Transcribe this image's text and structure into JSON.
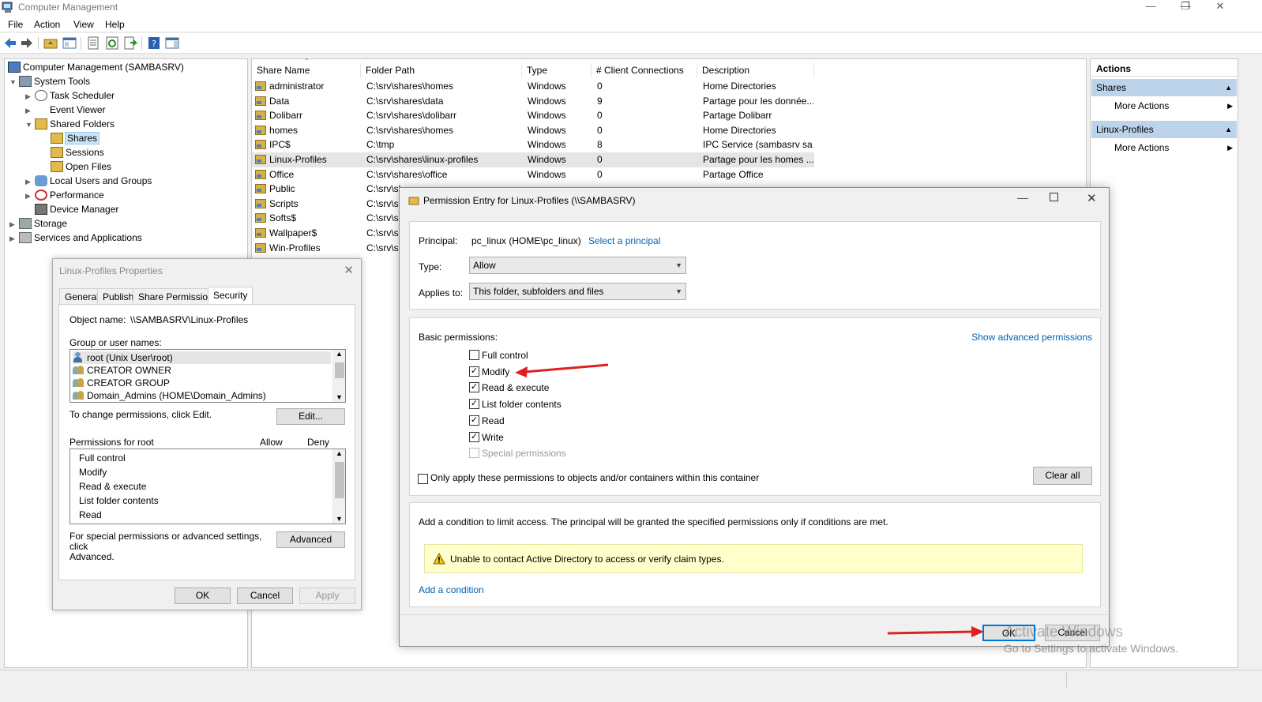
{
  "window": {
    "title": "Computer Management",
    "controls": [
      "minimize",
      "restore",
      "close"
    ]
  },
  "menu": [
    "File",
    "Action",
    "View",
    "Help"
  ],
  "toolbar": [
    "back-icon",
    "forward-icon",
    "up-folder-icon",
    "show-hide-tree-icon",
    "properties-icon",
    "refresh-icon",
    "export-list-icon",
    "help-icon",
    "action-pane-icon"
  ],
  "tree": {
    "root": "Computer Management (SAMBASRV)",
    "system_tools": "System Tools",
    "task_scheduler": "Task Scheduler",
    "event_viewer": "Event Viewer",
    "shared_folders": "Shared Folders",
    "shares": "Shares",
    "sessions": "Sessions",
    "open_files": "Open Files",
    "local_users": "Local Users and Groups",
    "performance": "Performance",
    "device_manager": "Device Manager",
    "storage": "Storage",
    "services": "Services and Applications"
  },
  "list": {
    "columns": [
      "Share Name",
      "Folder Path",
      "Type",
      "# Client Connections",
      "Description"
    ],
    "rows": [
      {
        "name": "administrator",
        "path": "C:\\srv\\shares\\homes",
        "type": "Windows",
        "conn": "0",
        "desc": "Home Directories"
      },
      {
        "name": "Data",
        "path": "C:\\srv\\shares\\data",
        "type": "Windows",
        "conn": "9",
        "desc": "Partage pour les donnée..."
      },
      {
        "name": "Dolibarr",
        "path": "C:\\srv\\shares\\dolibarr",
        "type": "Windows",
        "conn": "0",
        "desc": "Partage Dolibarr"
      },
      {
        "name": "homes",
        "path": "C:\\srv\\shares\\homes",
        "type": "Windows",
        "conn": "0",
        "desc": "Home Directories"
      },
      {
        "name": "IPC$",
        "path": "C:\\tmp",
        "type": "Windows",
        "conn": "8",
        "desc": "IPC Service (sambasrv sa..."
      },
      {
        "name": "Linux-Profiles",
        "path": "C:\\srv\\shares\\linux-profiles",
        "type": "Windows",
        "conn": "0",
        "desc": "Partage pour les homes ..."
      },
      {
        "name": "Office",
        "path": "C:\\srv\\shares\\office",
        "type": "Windows",
        "conn": "0",
        "desc": "Partage Office"
      },
      {
        "name": "Public",
        "path": "C:\\srv\\sl",
        "type": "",
        "conn": "",
        "desc": ""
      },
      {
        "name": "Scripts",
        "path": "C:\\srv\\sl",
        "type": "",
        "conn": "",
        "desc": ""
      },
      {
        "name": "Softs$",
        "path": "C:\\srv\\sl",
        "type": "",
        "conn": "",
        "desc": ""
      },
      {
        "name": "Wallpaper$",
        "path": "C:\\srv\\sl",
        "type": "",
        "conn": "",
        "desc": ""
      },
      {
        "name": "Win-Profiles",
        "path": "C:\\srv\\sl",
        "type": "",
        "conn": "",
        "desc": ""
      }
    ]
  },
  "actions": {
    "header": "Actions",
    "section1": "Shares",
    "section1_item": "More Actions",
    "section2": "Linux-Profiles",
    "section2_item": "More Actions"
  },
  "props": {
    "title": "Linux-Profiles Properties",
    "tabs": [
      "General",
      "Publish",
      "Share Permissions",
      "Security"
    ],
    "object_label": "Object name:",
    "object_value": "\\\\SAMBASRV\\Linux-Profiles",
    "group_label": "Group or user names:",
    "users": [
      "root (Unix User\\root)",
      "CREATOR OWNER",
      "CREATOR GROUP",
      "Domain_Admins (HOME\\Domain_Admins)"
    ],
    "change_text": "To change permissions, click Edit.",
    "edit_button": "Edit...",
    "perms_for": "Permissions for root",
    "allow_col": "Allow",
    "deny_col": "Deny",
    "perms": [
      "Full control",
      "Modify",
      "Read & execute",
      "List folder contents",
      "Read"
    ],
    "special_text_1": "For special permissions or advanced settings, click",
    "special_text_2": "Advanced.",
    "advanced_button": "Advanced",
    "ok": "OK",
    "cancel": "Cancel",
    "apply": "Apply"
  },
  "perm_entry": {
    "title": "Permission Entry for Linux-Profiles (\\\\SAMBASRV)",
    "principal_label": "Principal:",
    "principal_value": "pc_linux (HOME\\pc_linux)",
    "select_principal": "Select a principal",
    "type_label": "Type:",
    "type_value": "Allow",
    "applies_label": "Applies to:",
    "applies_value": "This folder, subfolders and files",
    "basic_label": "Basic permissions:",
    "show_advanced": "Show advanced permissions",
    "permissions": [
      {
        "label": "Full control",
        "checked": false,
        "disabled": false
      },
      {
        "label": "Modify",
        "checked": true,
        "disabled": false
      },
      {
        "label": "Read & execute",
        "checked": true,
        "disabled": false
      },
      {
        "label": "List folder contents",
        "checked": true,
        "disabled": false
      },
      {
        "label": "Read",
        "checked": true,
        "disabled": false
      },
      {
        "label": "Write",
        "checked": true,
        "disabled": false
      },
      {
        "label": "Special permissions",
        "checked": false,
        "disabled": true
      }
    ],
    "only_apply": "Only apply these permissions to objects and/or containers within this container",
    "clear_all": "Clear all",
    "condition_text": "Add a condition to limit access. The principal will be granted the specified permissions only if conditions are met.",
    "warning_text": "Unable to contact Active Directory to access or verify claim types.",
    "add_condition": "Add a condition",
    "ok": "OK",
    "cancel": "Cancel"
  },
  "watermark": {
    "line1": "Activate Windows",
    "line2": "Go to Settings to activate Windows."
  },
  "colors": {
    "selection": "#cce4f7",
    "action_section": "#bcd3ea",
    "link": "#0063b1",
    "annotation_arrow": "#e02020",
    "warning_bg": "#ffffcc"
  }
}
